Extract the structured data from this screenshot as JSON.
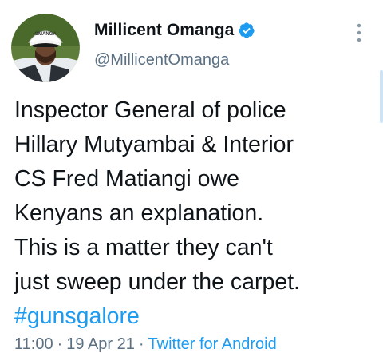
{
  "tweet": {
    "author": {
      "display_name": "Millicent Omanga",
      "handle": "@MillicentOmanga",
      "verified": true,
      "avatar_hat_text": "OMANGA"
    },
    "body_lines": [
      "Inspector General of police",
      "Hillary Mutyambai & Interior",
      "CS Fred Matiangi owe",
      "Kenyans an explanation.",
      "This is a matter they can't",
      "just sweep under the carpet."
    ],
    "hashtag": "#gunsgalore",
    "meta": {
      "time": "11:00",
      "separator": "·",
      "date": "19 Apr 21",
      "source": "Twitter for Android"
    }
  },
  "colors": {
    "text": "#0f1419",
    "secondary": "#5b7083",
    "link": "#1d9bf0",
    "verified": "#1d9bf0"
  },
  "icons": {
    "verified": "verified-badge-icon",
    "more": "more-vertical-icon"
  }
}
